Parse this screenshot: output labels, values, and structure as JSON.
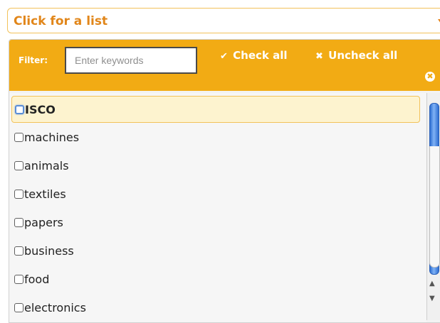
{
  "select": {
    "label": "Click for a list",
    "arrow_icon": "caret-down-icon"
  },
  "header": {
    "filter_label": "Filter:",
    "filter_placeholder": "Enter keywords",
    "check_all_label": "Check all",
    "uncheck_all_label": "Uncheck all",
    "check_icon": "✔",
    "uncheck_icon": "✖",
    "close_icon": "✖"
  },
  "options": [
    {
      "label": "ISCO",
      "checked": false,
      "active": true
    },
    {
      "label": "machines",
      "checked": false,
      "active": false
    },
    {
      "label": "animals",
      "checked": false,
      "active": false
    },
    {
      "label": "textiles",
      "checked": false,
      "active": false
    },
    {
      "label": "papers",
      "checked": false,
      "active": false
    },
    {
      "label": "business",
      "checked": false,
      "active": false
    },
    {
      "label": "food",
      "checked": false,
      "active": false
    },
    {
      "label": "electronics",
      "checked": false,
      "active": false
    }
  ],
  "scroll": {
    "up_arrow": "▲",
    "down_arrow": "▼"
  },
  "colors": {
    "accent": "#f2ab14",
    "label": "#e1861a",
    "active_bg": "#fdf3cf",
    "active_border": "#f2c25a",
    "checkbox_focus": "#5b8ed6"
  }
}
